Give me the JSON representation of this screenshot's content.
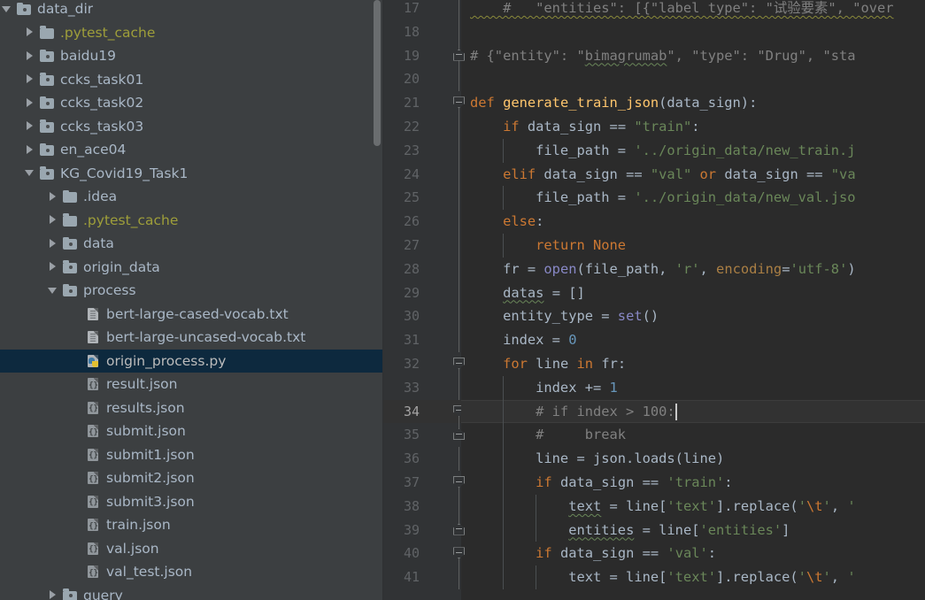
{
  "project_tree": {
    "scrollbar": {
      "visible": true
    },
    "items": [
      {
        "label": "data_dir",
        "depth": 1,
        "toggle": "open",
        "icon": "folder-module-icon",
        "color": "#a9b7c6",
        "type": "folder"
      },
      {
        "label": ".pytest_cache",
        "depth": 2,
        "toggle": "closed",
        "icon": "folder-excluded-icon",
        "color": "#9e9e3a",
        "type": "folder"
      },
      {
        "label": "baidu19",
        "depth": 2,
        "toggle": "closed",
        "icon": "folder-module-icon",
        "color": "#a9b7c6",
        "type": "folder"
      },
      {
        "label": "ccks_task01",
        "depth": 2,
        "toggle": "closed",
        "icon": "folder-module-icon",
        "color": "#a9b7c6",
        "type": "folder"
      },
      {
        "label": "ccks_task02",
        "depth": 2,
        "toggle": "closed",
        "icon": "folder-module-icon",
        "color": "#a9b7c6",
        "type": "folder"
      },
      {
        "label": "ccks_task03",
        "depth": 2,
        "toggle": "closed",
        "icon": "folder-module-icon",
        "color": "#a9b7c6",
        "type": "folder"
      },
      {
        "label": "en_ace04",
        "depth": 2,
        "toggle": "closed",
        "icon": "folder-module-icon",
        "color": "#a9b7c6",
        "type": "folder"
      },
      {
        "label": "KG_Covid19_Task1",
        "depth": 2,
        "toggle": "open",
        "icon": "folder-module-icon",
        "color": "#a9b7c6",
        "type": "folder"
      },
      {
        "label": ".idea",
        "depth": 3,
        "toggle": "closed",
        "icon": "folder-icon",
        "color": "#a9b7c6",
        "type": "folder"
      },
      {
        "label": ".pytest_cache",
        "depth": 3,
        "toggle": "closed",
        "icon": "folder-excluded-icon",
        "color": "#9e9e3a",
        "type": "folder"
      },
      {
        "label": "data",
        "depth": 3,
        "toggle": "closed",
        "icon": "folder-module-icon",
        "color": "#a9b7c6",
        "type": "folder"
      },
      {
        "label": "origin_data",
        "depth": 3,
        "toggle": "closed",
        "icon": "folder-module-icon",
        "color": "#a9b7c6",
        "type": "folder"
      },
      {
        "label": "process",
        "depth": 3,
        "toggle": "open",
        "icon": "folder-module-icon",
        "color": "#a9b7c6",
        "type": "folder"
      },
      {
        "label": "bert-large-cased-vocab.txt",
        "depth": 4,
        "toggle": "none",
        "icon": "text-file-icon",
        "color": "#a9b7c6",
        "type": "file"
      },
      {
        "label": "bert-large-uncased-vocab.txt",
        "depth": 4,
        "toggle": "none",
        "icon": "text-file-icon",
        "color": "#a9b7c6",
        "type": "file"
      },
      {
        "label": "origin_process.py",
        "depth": 4,
        "toggle": "none",
        "icon": "python-file-icon",
        "color": "#bbbbbb",
        "type": "file",
        "selected": true
      },
      {
        "label": "result.json",
        "depth": 4,
        "toggle": "none",
        "icon": "json-file-icon",
        "color": "#a9b7c6",
        "type": "file"
      },
      {
        "label": "results.json",
        "depth": 4,
        "toggle": "none",
        "icon": "json-file-icon",
        "color": "#a9b7c6",
        "type": "file"
      },
      {
        "label": "submit.json",
        "depth": 4,
        "toggle": "none",
        "icon": "json-file-icon",
        "color": "#a9b7c6",
        "type": "file"
      },
      {
        "label": "submit1.json",
        "depth": 4,
        "toggle": "none",
        "icon": "json-file-icon",
        "color": "#a9b7c6",
        "type": "file"
      },
      {
        "label": "submit2.json",
        "depth": 4,
        "toggle": "none",
        "icon": "json-file-icon",
        "color": "#a9b7c6",
        "type": "file"
      },
      {
        "label": "submit3.json",
        "depth": 4,
        "toggle": "none",
        "icon": "json-file-icon",
        "color": "#a9b7c6",
        "type": "file"
      },
      {
        "label": "train.json",
        "depth": 4,
        "toggle": "none",
        "icon": "json-file-icon",
        "color": "#a9b7c6",
        "type": "file"
      },
      {
        "label": "val.json",
        "depth": 4,
        "toggle": "none",
        "icon": "json-file-icon",
        "color": "#a9b7c6",
        "type": "file"
      },
      {
        "label": "val_test.json",
        "depth": 4,
        "toggle": "none",
        "icon": "json-file-icon",
        "color": "#a9b7c6",
        "type": "file"
      },
      {
        "label": "query",
        "depth": 3,
        "toggle": "closed",
        "icon": "folder-module-icon",
        "color": "#a9b7c6",
        "type": "folder"
      }
    ]
  },
  "editor": {
    "current_line": 34,
    "caret": {
      "line": 34,
      "column": 22
    },
    "lines": [
      {
        "num": 17,
        "fold": null,
        "stem": true,
        "indents": [],
        "tokens": [
          {
            "t": "    #   \"entities\": [{\"label type\": \"试验要素\", \"over",
            "c": "c",
            "sq": "typo"
          }
        ]
      },
      {
        "num": 18,
        "fold": null,
        "stem": true,
        "indents": [],
        "tokens": []
      },
      {
        "num": 19,
        "fold": "close",
        "stem": true,
        "indents": [],
        "tokens": [
          {
            "t": "# {\"entity\": \"",
            "c": "c"
          },
          {
            "t": "bimagrumab",
            "c": "c",
            "sq": "spell"
          },
          {
            "t": "\", \"type\": \"Drug\", \"sta",
            "c": "c"
          }
        ]
      },
      {
        "num": 20,
        "fold": null,
        "stem": true,
        "indents": [],
        "tokens": []
      },
      {
        "num": 21,
        "fold": "open",
        "stem": false,
        "indents": [],
        "tokens": [
          {
            "t": "def ",
            "c": "k"
          },
          {
            "t": "generate_train_json",
            "c": "f"
          },
          {
            "t": "(data_sign):",
            "c": "p"
          }
        ]
      },
      {
        "num": 22,
        "fold": null,
        "stem": true,
        "indents": [],
        "tokens": [
          {
            "t": "    ",
            "c": "p"
          },
          {
            "t": "if ",
            "c": "k"
          },
          {
            "t": "data_sign == ",
            "c": "p"
          },
          {
            "t": "\"train\"",
            "c": "s"
          },
          {
            "t": ":",
            "c": "p"
          }
        ]
      },
      {
        "num": 23,
        "fold": null,
        "stem": true,
        "indents": [
          1
        ],
        "tokens": [
          {
            "t": "        file_path = ",
            "c": "p"
          },
          {
            "t": "'../origin_data/new_train.j",
            "c": "s"
          }
        ]
      },
      {
        "num": 24,
        "fold": null,
        "stem": true,
        "indents": [],
        "tokens": [
          {
            "t": "    ",
            "c": "p"
          },
          {
            "t": "elif ",
            "c": "k"
          },
          {
            "t": "data_sign == ",
            "c": "p"
          },
          {
            "t": "\"val\"",
            "c": "s"
          },
          {
            "t": " or ",
            "c": "k"
          },
          {
            "t": "data_sign == ",
            "c": "p"
          },
          {
            "t": "\"va",
            "c": "s"
          }
        ]
      },
      {
        "num": 25,
        "fold": null,
        "stem": true,
        "indents": [
          1
        ],
        "tokens": [
          {
            "t": "        file_path = ",
            "c": "p"
          },
          {
            "t": "'../origin_data/new_val.jso",
            "c": "s"
          }
        ]
      },
      {
        "num": 26,
        "fold": null,
        "stem": true,
        "indents": [],
        "tokens": [
          {
            "t": "    ",
            "c": "p"
          },
          {
            "t": "else",
            "c": "k"
          },
          {
            "t": ":",
            "c": "p"
          }
        ]
      },
      {
        "num": 27,
        "fold": null,
        "stem": true,
        "indents": [
          1
        ],
        "tokens": [
          {
            "t": "        ",
            "c": "p"
          },
          {
            "t": "return None",
            "c": "k"
          }
        ]
      },
      {
        "num": 28,
        "fold": null,
        "stem": true,
        "indents": [],
        "tokens": [
          {
            "t": "    fr = ",
            "c": "p"
          },
          {
            "t": "open",
            "c": "b"
          },
          {
            "t": "(file_path, ",
            "c": "p"
          },
          {
            "t": "'r'",
            "c": "s"
          },
          {
            "t": ", ",
            "c": "p"
          },
          {
            "t": "encoding",
            "c": "kw"
          },
          {
            "t": "=",
            "c": "p"
          },
          {
            "t": "'utf-8'",
            "c": "s"
          },
          {
            "t": ")",
            "c": "p"
          }
        ]
      },
      {
        "num": 29,
        "fold": null,
        "stem": true,
        "indents": [],
        "tokens": [
          {
            "t": "    ",
            "c": "p"
          },
          {
            "t": "datas",
            "c": "p",
            "sq": "spell"
          },
          {
            "t": " = []",
            "c": "p"
          }
        ]
      },
      {
        "num": 30,
        "fold": null,
        "stem": true,
        "indents": [],
        "tokens": [
          {
            "t": "    entity_type = ",
            "c": "p"
          },
          {
            "t": "set",
            "c": "b"
          },
          {
            "t": "()",
            "c": "p"
          }
        ]
      },
      {
        "num": 31,
        "fold": null,
        "stem": true,
        "indents": [],
        "tokens": [
          {
            "t": "    index = ",
            "c": "p"
          },
          {
            "t": "0",
            "c": "n"
          }
        ]
      },
      {
        "num": 32,
        "fold": "open",
        "stem": false,
        "indents": [],
        "tokens": [
          {
            "t": "    ",
            "c": "p"
          },
          {
            "t": "for ",
            "c": "k"
          },
          {
            "t": "line ",
            "c": "p"
          },
          {
            "t": "in ",
            "c": "k"
          },
          {
            "t": "fr:",
            "c": "p"
          }
        ]
      },
      {
        "num": 33,
        "fold": null,
        "stem": true,
        "indents": [
          1
        ],
        "tokens": [
          {
            "t": "        index += ",
            "c": "p"
          },
          {
            "t": "1",
            "c": "n"
          }
        ]
      },
      {
        "num": 34,
        "fold": "open",
        "stem": false,
        "indents": [
          1
        ],
        "current": true,
        "tokens": [
          {
            "t": "        # if index > 100:",
            "c": "c"
          }
        ]
      },
      {
        "num": 35,
        "fold": "close",
        "stem": false,
        "indents": [
          1
        ],
        "tokens": [
          {
            "t": "        #     break",
            "c": "c"
          }
        ]
      },
      {
        "num": 36,
        "fold": null,
        "stem": true,
        "indents": [
          1
        ],
        "tokens": [
          {
            "t": "        line = json.loads(line)",
            "c": "p"
          }
        ]
      },
      {
        "num": 37,
        "fold": "open",
        "stem": false,
        "indents": [
          1
        ],
        "tokens": [
          {
            "t": "        ",
            "c": "p"
          },
          {
            "t": "if ",
            "c": "k"
          },
          {
            "t": "data_sign == ",
            "c": "p"
          },
          {
            "t": "'train'",
            "c": "s"
          },
          {
            "t": ":",
            "c": "p"
          }
        ]
      },
      {
        "num": 38,
        "fold": null,
        "stem": true,
        "indents": [
          1,
          2
        ],
        "tokens": [
          {
            "t": "            ",
            "c": "p"
          },
          {
            "t": "text",
            "c": "p",
            "sq": "spell"
          },
          {
            "t": " = line[",
            "c": "p"
          },
          {
            "t": "'text'",
            "c": "s"
          },
          {
            "t": "].replace(",
            "c": "p"
          },
          {
            "t": "'",
            "c": "s"
          },
          {
            "t": "\\t",
            "c": "e"
          },
          {
            "t": "'",
            "c": "s"
          },
          {
            "t": ", ",
            "c": "p"
          },
          {
            "t": "'",
            "c": "s"
          }
        ]
      },
      {
        "num": 39,
        "fold": "close",
        "stem": false,
        "indents": [
          1,
          2
        ],
        "tokens": [
          {
            "t": "            ",
            "c": "p"
          },
          {
            "t": "entities",
            "c": "p",
            "sq": "spell"
          },
          {
            "t": " = line[",
            "c": "p"
          },
          {
            "t": "'entities'",
            "c": "s"
          },
          {
            "t": "]",
            "c": "p"
          }
        ]
      },
      {
        "num": 40,
        "fold": "open",
        "stem": false,
        "indents": [
          1
        ],
        "tokens": [
          {
            "t": "        ",
            "c": "p"
          },
          {
            "t": "if ",
            "c": "k"
          },
          {
            "t": "data_sign == ",
            "c": "p"
          },
          {
            "t": "'val'",
            "c": "s"
          },
          {
            "t": ":",
            "c": "p"
          }
        ]
      },
      {
        "num": 41,
        "fold": null,
        "stem": true,
        "indents": [
          1,
          2
        ],
        "tokens": [
          {
            "t": "            text = line[",
            "c": "p"
          },
          {
            "t": "'text'",
            "c": "s"
          },
          {
            "t": "].replace(",
            "c": "p"
          },
          {
            "t": "'",
            "c": "s"
          },
          {
            "t": "\\t",
            "c": "e"
          },
          {
            "t": "'",
            "c": "s"
          },
          {
            "t": ", ",
            "c": "p"
          },
          {
            "t": "'",
            "c": "s"
          }
        ]
      }
    ]
  }
}
